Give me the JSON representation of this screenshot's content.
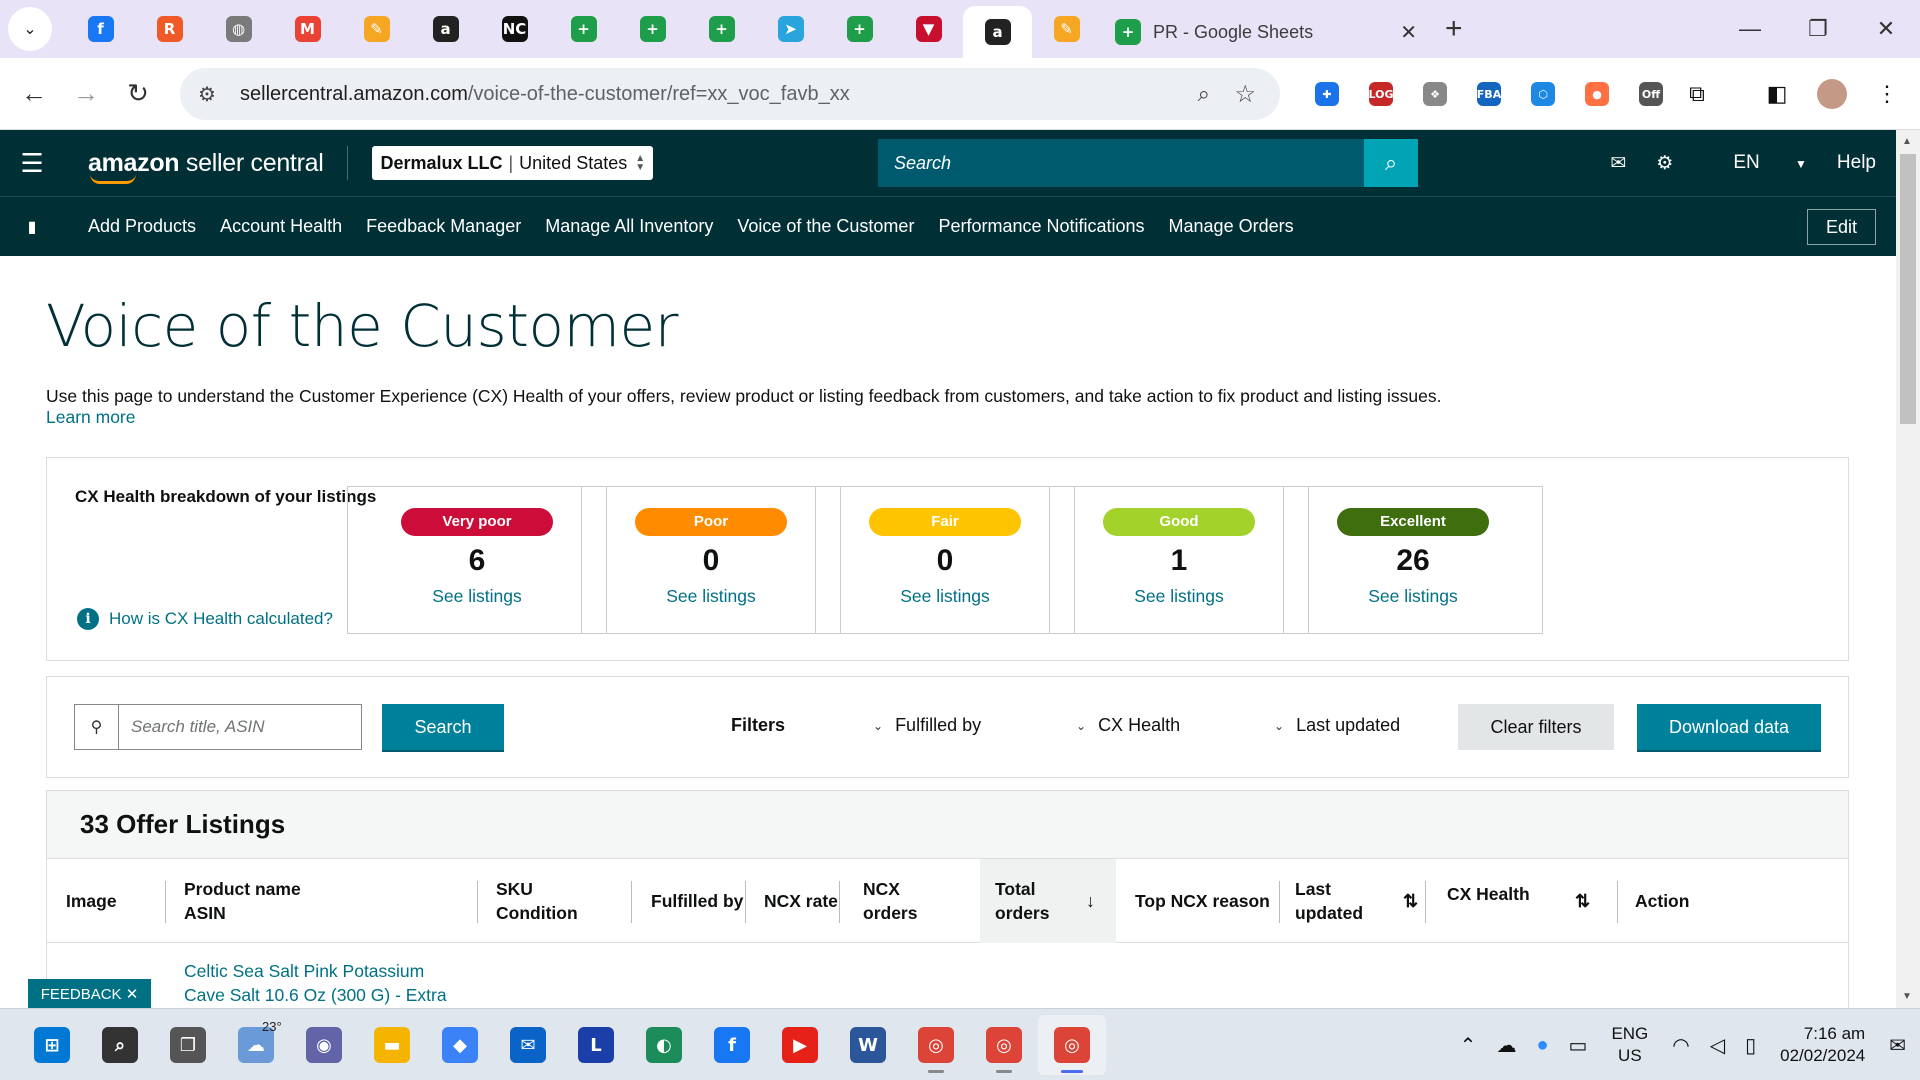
{
  "browser": {
    "pinned_tabs": [
      {
        "icon": "facebook-icon",
        "glyph": "f",
        "color": "#1877f2"
      },
      {
        "icon": "reddit-style-icon",
        "glyph": "R",
        "color": "#f05a28"
      },
      {
        "icon": "globe-icon",
        "glyph": "◍",
        "color": "#7a7a7a"
      },
      {
        "icon": "gmail-icon",
        "glyph": "M",
        "color": "#ea4335"
      },
      {
        "icon": "pencil-app-icon",
        "glyph": "✎",
        "color": "#f5a623"
      },
      {
        "icon": "amazon-icon",
        "glyph": "a",
        "color": "#222222"
      },
      {
        "icon": "nc-icon",
        "glyph": "NC",
        "color": "#111111"
      },
      {
        "icon": "sheets-icon",
        "glyph": "+",
        "color": "#1e9e4a"
      },
      {
        "icon": "sheets-icon",
        "glyph": "+",
        "color": "#1e9e4a"
      },
      {
        "icon": "sheets-icon",
        "glyph": "+",
        "color": "#1e9e4a"
      },
      {
        "icon": "telegram-icon",
        "glyph": "➤",
        "color": "#2aa4dc"
      },
      {
        "icon": "sheets-icon",
        "glyph": "+",
        "color": "#1e9e4a"
      },
      {
        "icon": "flag-icon",
        "glyph": "▼",
        "color": "#c8102e"
      },
      {
        "icon": "amazon-icon",
        "glyph": "a",
        "color": "#222222",
        "active": true
      },
      {
        "icon": "pencil-app-icon",
        "glyph": "✎",
        "color": "#f5a623"
      }
    ],
    "main_tab_title": "PR - Google Sheets",
    "url_host": "sellercentral.amazon.com",
    "url_path": "/voice-of-the-customer/ref=xx_voc_favb_xx",
    "extensions": [
      {
        "icon": "extension-blue-icon",
        "glyph": "✚",
        "color": "#1a73e8"
      },
      {
        "icon": "login-extension-icon",
        "glyph": "LOG",
        "color": "#c62828"
      },
      {
        "icon": "extension-icon",
        "glyph": "❖",
        "color": "#888888"
      },
      {
        "icon": "fba-extension-icon",
        "glyph": "FBA",
        "color": "#1565c0"
      },
      {
        "icon": "extension-blue-icon",
        "glyph": "⬡",
        "color": "#1e88e5"
      },
      {
        "icon": "extension-orange-icon",
        "glyph": "●",
        "color": "#ff7043"
      },
      {
        "icon": "off-extension-icon",
        "glyph": "Off",
        "color": "#555555"
      }
    ]
  },
  "header": {
    "logo_bold": "amazon",
    "logo_rest": " seller central",
    "account_name": "Dermalux LLC",
    "account_region": "United States",
    "search_placeholder": "Search",
    "language": "EN",
    "help": "Help"
  },
  "nav": {
    "links": [
      "Add Products",
      "Account Health",
      "Feedback Manager",
      "Manage All Inventory",
      "Voice of the Customer",
      "Performance Notifications",
      "Manage Orders"
    ],
    "edit": "Edit"
  },
  "page": {
    "title": "Voice of the Customer",
    "intro": "Use this page to understand the Customer Experience (CX) Health of your offers, review product or listing feedback from customers, and take action to fix product and listing issues.",
    "learn_more": "Learn more"
  },
  "health": {
    "label": "CX Health breakdown of your listings",
    "how_link": "How is CX Health calculated?",
    "tiles": [
      {
        "badge": "Very poor",
        "color": "#cc0c39",
        "count": "6",
        "link": "See listings"
      },
      {
        "badge": "Poor",
        "color": "#ff8c00",
        "count": "0",
        "link": "See listings"
      },
      {
        "badge": "Fair",
        "color": "#ffc400",
        "count": "0",
        "link": "See listings"
      },
      {
        "badge": "Good",
        "color": "#a3d22a",
        "count": "1",
        "link": "See listings"
      },
      {
        "badge": "Excellent",
        "color": "#3f6e0f",
        "count": "26",
        "link": "See listings"
      }
    ]
  },
  "filters": {
    "search_placeholder": "Search title, ASIN",
    "search_button": "Search",
    "filters_label": "Filters",
    "fulfilled_by": "Fulfilled by",
    "cx_health": "CX Health",
    "last_updated": "Last updated",
    "clear": "Clear filters",
    "download": "Download data"
  },
  "listings": {
    "heading": "33 Offer Listings",
    "columns": {
      "image": "Image",
      "product_name": "Product name",
      "asin": "ASIN",
      "sku": "SKU",
      "condition": "Condition",
      "fulfilled_by": "Fulfilled by",
      "ncx_rate": "NCX rate",
      "ncx_orders_1": "NCX",
      "ncx_orders_2": "orders",
      "total_orders_1": "Total",
      "total_orders_2": "orders",
      "top_reason": "Top NCX reason",
      "last_updated_1": "Last",
      "last_updated_2": "updated",
      "cx_health": "CX Health",
      "action": "Action"
    },
    "first_row_product_line1": "Celtic Sea Salt Pink Potassium",
    "first_row_product_line2": "Cave Salt 10.6 Oz (300 G) - Extra"
  },
  "feedback_tab": "FEEDBACK ✕",
  "taskbar": {
    "temperature": "23°",
    "language_line1": "ENG",
    "language_line2": "US",
    "time": "7:16 am",
    "date": "02/02/2024",
    "apps": [
      {
        "icon": "windows-start-icon",
        "glyph": "⊞",
        "color": "#0078d4"
      },
      {
        "icon": "search-icon",
        "glyph": "⌕",
        "color": "#333333"
      },
      {
        "icon": "task-view-icon",
        "glyph": "❐",
        "color": "#555555"
      },
      {
        "icon": "weather-icon",
        "glyph": "☁",
        "color": "#6a9bd8"
      },
      {
        "icon": "teams-chat-icon",
        "glyph": "◉",
        "color": "#6264a7"
      },
      {
        "icon": "file-explorer-icon",
        "glyph": "▬",
        "color": "#f4b400"
      },
      {
        "icon": "copilot-icon",
        "glyph": "◆",
        "color": "#3b82f6"
      },
      {
        "icon": "mail-icon",
        "glyph": "✉",
        "color": "#0a64c8"
      },
      {
        "icon": "l-app-icon",
        "glyph": "L",
        "color": "#1a3fa8"
      },
      {
        "icon": "edge-icon",
        "glyph": "◐",
        "color": "#1c8c5a"
      },
      {
        "icon": "facebook-icon",
        "glyph": "f",
        "color": "#1877f2"
      },
      {
        "icon": "youtube-icon",
        "glyph": "▶",
        "color": "#e62117"
      },
      {
        "icon": "word-icon",
        "glyph": "W",
        "color": "#2b579a"
      },
      {
        "icon": "chrome-icon",
        "glyph": "◎",
        "color": "#db4437"
      },
      {
        "icon": "chrome-profile-icon",
        "glyph": "◎",
        "color": "#db4437"
      },
      {
        "icon": "chrome-profile-icon",
        "glyph": "◎",
        "color": "#db4437",
        "active": true
      }
    ]
  }
}
